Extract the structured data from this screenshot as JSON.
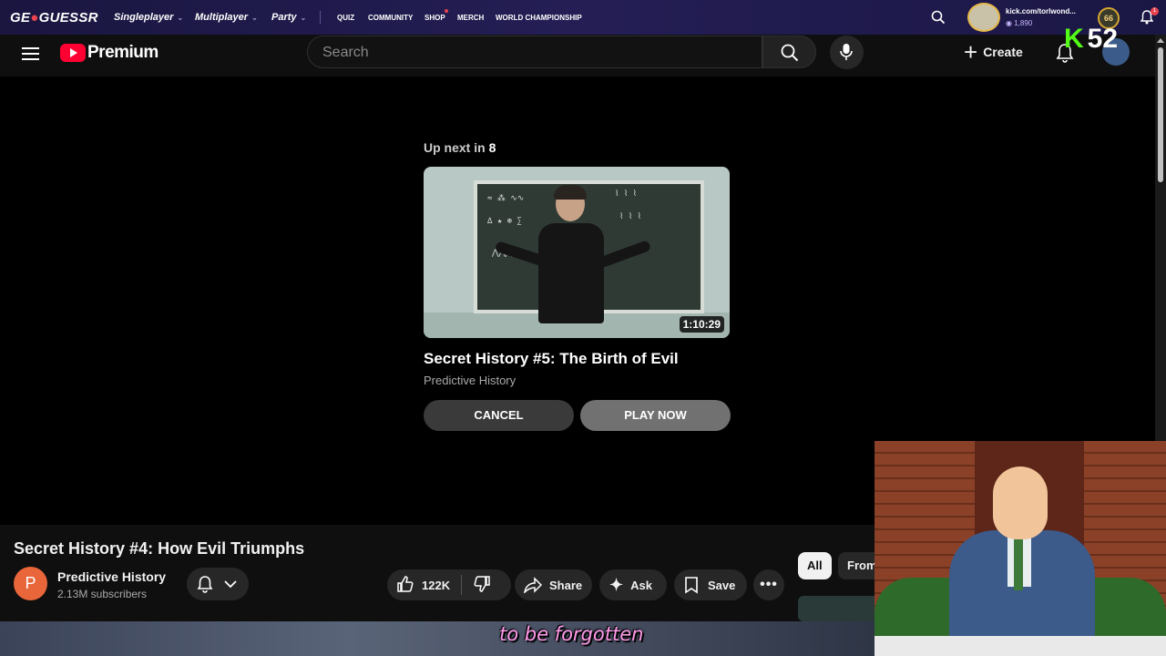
{
  "geo": {
    "logo_prefix": "GE",
    "logo_suffix": "GUESSR",
    "nav": [
      "Singleplayer",
      "Multiplayer",
      "Party"
    ],
    "small_nav": [
      "QUIZ",
      "COMMUNITY",
      "SHOP",
      "MERCH",
      "WORLD CHAMPIONSHIP"
    ],
    "username": "kick.com/torlwond...",
    "xp": "1,890",
    "level": "66",
    "notification_count": "1"
  },
  "youtube": {
    "logo_text": "Premium",
    "search_placeholder": "Search",
    "create_label": "Create"
  },
  "kick_overlay": {
    "k": "K",
    "number": "52"
  },
  "upnext": {
    "label": "Up next in",
    "countdown": "8",
    "duration": "1:10:29",
    "title": "Secret History #5: The Birth of Evil",
    "channel": "Predictive History",
    "cancel": "CANCEL",
    "play_now": "PLAY NOW"
  },
  "video": {
    "title": "Secret History #4: How Evil Triumphs",
    "channel_initial": "P",
    "channel": "Predictive History",
    "subscribers": "2.13M subscribers",
    "likes": "122K",
    "share": "Share",
    "ask": "Ask",
    "save": "Save"
  },
  "chips": [
    "All",
    "From"
  ],
  "caption": "to be forgotten"
}
